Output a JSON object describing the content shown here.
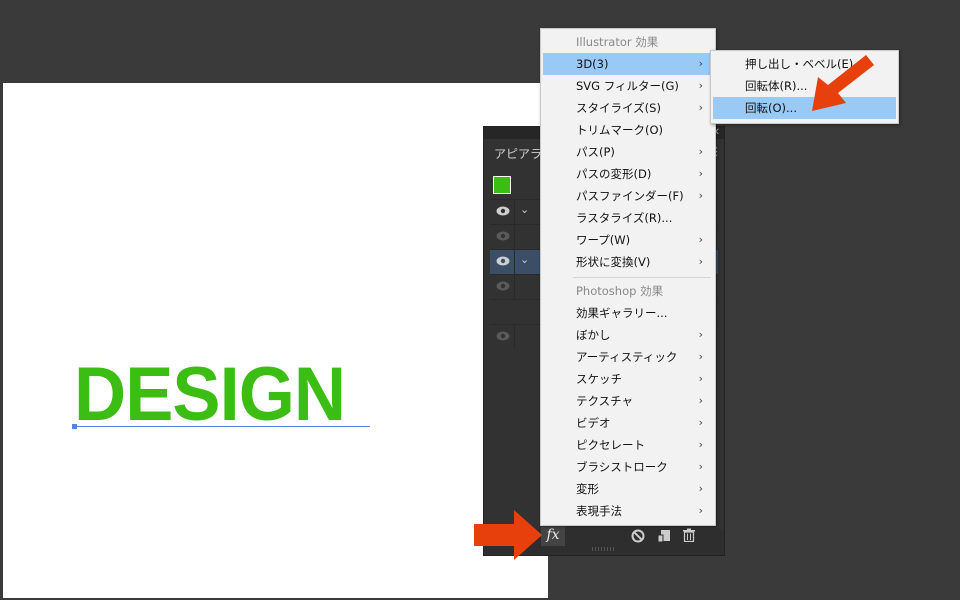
{
  "canvas": {
    "art_text": "DESIGN",
    "art_color": "#3bbd14",
    "path_color": "#5b7fe0"
  },
  "appearance_panel": {
    "title": "アピアランス",
    "close_icon": "close-icon",
    "menu_icon": "panel-menu-icon",
    "fill_swatch_color": "#3bbd14",
    "rows": [
      {
        "type": "swatch"
      },
      {
        "type": "eye-expand",
        "selected": false
      },
      {
        "type": "eye-dim"
      },
      {
        "type": "eye-expand",
        "selected": true
      },
      {
        "type": "eye-dim"
      },
      {
        "type": "blank"
      },
      {
        "type": "eye-dim"
      }
    ],
    "bottom_toolbar": {
      "fx_label": "fx",
      "icons": [
        "clear-appearance-icon",
        "duplicate-item-icon",
        "delete-item-icon"
      ]
    }
  },
  "effect_menu": {
    "sections": [
      {
        "header": "Illustrator 効果",
        "items": [
          {
            "label": "3D(3)",
            "submenu": true,
            "highlighted": true
          },
          {
            "label": "SVG フィルター(G)",
            "submenu": true
          },
          {
            "label": "スタイライズ(S)",
            "submenu": true
          },
          {
            "label": "トリムマーク(O)",
            "submenu": false
          },
          {
            "label": "パス(P)",
            "submenu": true
          },
          {
            "label": "パスの変形(D)",
            "submenu": true
          },
          {
            "label": "パスファインダー(F)",
            "submenu": true
          },
          {
            "label": "ラスタライズ(R)...",
            "submenu": false
          },
          {
            "label": "ワープ(W)",
            "submenu": true
          },
          {
            "label": "形状に変換(V)",
            "submenu": true
          }
        ]
      },
      {
        "header": "Photoshop 効果",
        "items": [
          {
            "label": "効果ギャラリー...",
            "submenu": false
          },
          {
            "label": "ぼかし",
            "submenu": true
          },
          {
            "label": "アーティスティック",
            "submenu": true
          },
          {
            "label": "スケッチ",
            "submenu": true
          },
          {
            "label": "テクスチャ",
            "submenu": true
          },
          {
            "label": "ビデオ",
            "submenu": true
          },
          {
            "label": "ピクセレート",
            "submenu": true
          },
          {
            "label": "ブラシストローク",
            "submenu": true
          },
          {
            "label": "変形",
            "submenu": true
          },
          {
            "label": "表現手法",
            "submenu": true
          }
        ]
      }
    ],
    "arrow_glyph": "›"
  },
  "submenu_3d": {
    "items": [
      {
        "label": "押し出し・ベベル(E)...",
        "highlighted": false
      },
      {
        "label": "回転体(R)...",
        "highlighted": false
      },
      {
        "label": "回転(O)...",
        "highlighted": true
      }
    ]
  },
  "annotations": {
    "arrow_color": "#e8400c"
  }
}
